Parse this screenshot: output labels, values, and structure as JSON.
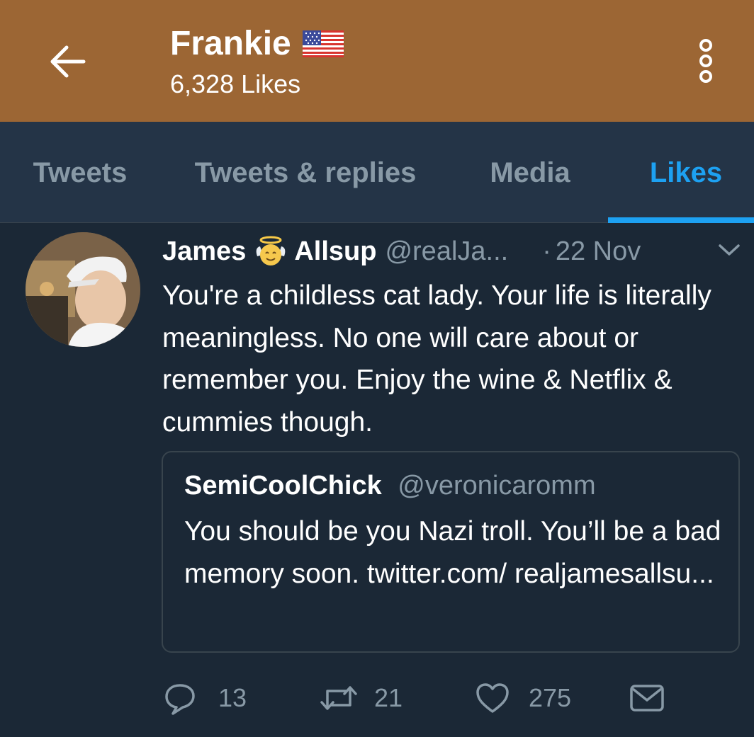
{
  "header": {
    "title": "Frankie",
    "subtitle": "6,328 Likes",
    "back_icon": "arrow-left-icon",
    "flag_icon": "us-flag-icon",
    "more_icon": "vertical-dots-icon",
    "background": "#9c6634"
  },
  "tabs": [
    {
      "label": "Tweets",
      "active": false
    },
    {
      "label": "Tweets & replies",
      "active": false
    },
    {
      "label": "Media",
      "active": false
    },
    {
      "label": "Likes",
      "active": true
    }
  ],
  "tweet": {
    "author_first": "James",
    "author_last": "Allsup",
    "author_emoji": "angel-emoji-icon",
    "handle": "@realJa...",
    "separator": "·",
    "date": "22 Nov",
    "text": "You're a childless cat lady. Your life is literally meaningless. No one will care about or remember you. Enjoy the wine & Netflix & cummies though.",
    "quote": {
      "name": "SemiCoolChick",
      "handle": "@veronicaromm",
      "text": "You should be you Nazi troll. You’ll be a bad memory soon. twitter.com/ realjamesallsu..."
    },
    "actions": {
      "replies": "13",
      "retweets": "21",
      "likes": "275"
    }
  },
  "colors": {
    "accent": "#1da1f2",
    "background": "#1b2836",
    "tab_bar": "#243447",
    "muted_text": "#8899a6"
  }
}
